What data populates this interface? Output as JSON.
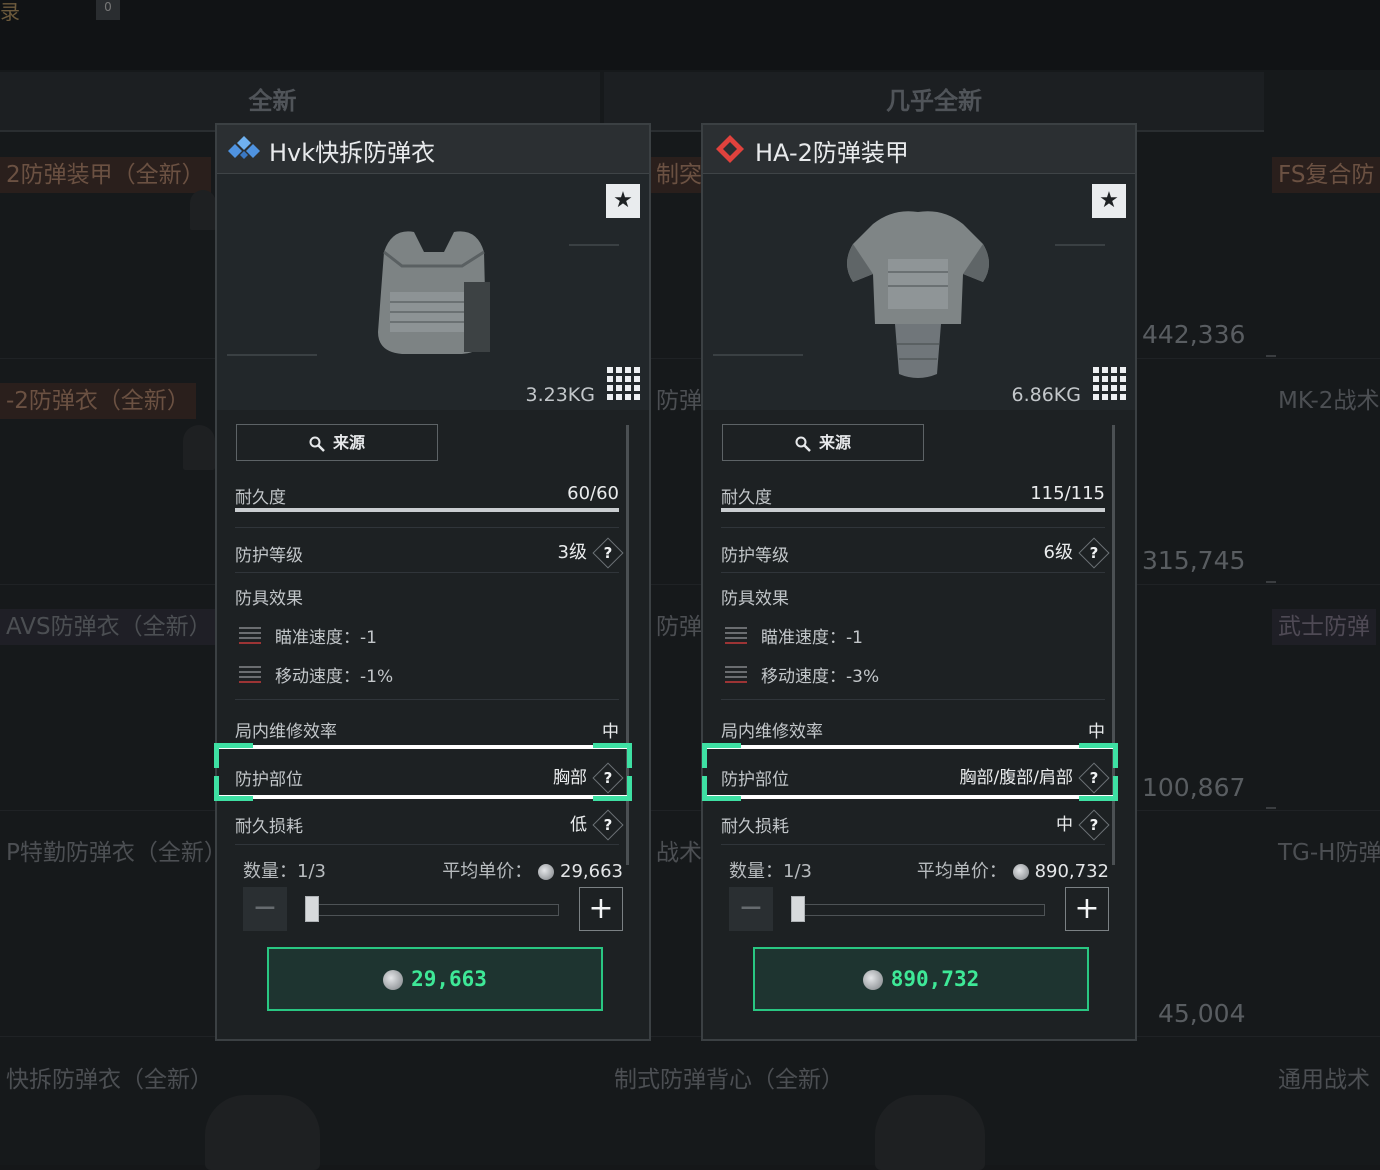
{
  "background": {
    "top_label": "录",
    "top_badge": "0",
    "column_headers": [
      "全新",
      "几乎全新"
    ],
    "left_items": [
      "2防弹装甲（全新）",
      "-2防弹衣（全新）",
      "AVS防弹衣（全新）",
      "P特勤防弹衣（全新）",
      "快拆防弹衣（全新）"
    ],
    "middle_items": [
      "制突击",
      "防弹",
      "防弹",
      "战术",
      "制式防弹背心（全新）"
    ],
    "right_items": [
      "FS复合防",
      "MK-2战术",
      "武士防弹",
      "TG-H防弹",
      "通用战术"
    ],
    "prices": [
      "442,336",
      "315,745",
      "100,867",
      "45,004"
    ]
  },
  "cards": [
    {
      "name": "Hvk快拆防弹衣",
      "quality_icon": "blue-diamonds-icon",
      "weight": "3.23KG",
      "source_label": "来源",
      "durability_label": "耐久度",
      "durability_value": "60/60",
      "durability_fraction": 1.0,
      "protection_level_label": "防护等级",
      "protection_level_value": "3级",
      "effects_label": "防具效果",
      "effect_aim": "瞄准速度：-1",
      "effect_move": "移动速度：-1%",
      "repair_label": "局内维修效率",
      "repair_value": "中",
      "area_label": "防护部位",
      "area_value": "胸部",
      "wear_label": "耐久损耗",
      "wear_value": "低",
      "qty_label": "数量：1/3",
      "avg_price_label": "平均单价：",
      "avg_price_value": "29,663",
      "buy_price": "29,663",
      "help_mark": "?",
      "favorite_glyph": "★",
      "minus_glyph": "−",
      "plus_glyph": "+"
    },
    {
      "name": "HA-2防弹装甲",
      "quality_icon": "red-diamond-icon",
      "weight": "6.86KG",
      "source_label": "来源",
      "durability_label": "耐久度",
      "durability_value": "115/115",
      "durability_fraction": 1.0,
      "protection_level_label": "防护等级",
      "protection_level_value": "6级",
      "effects_label": "防具效果",
      "effect_aim": "瞄准速度：-1",
      "effect_move": "移动速度：-3%",
      "repair_label": "局内维修效率",
      "repair_value": "中",
      "area_label": "防护部位",
      "area_value": "胸部/腹部/肩部",
      "wear_label": "耐久损耗",
      "wear_value": "中",
      "qty_label": "数量：1/3",
      "avg_price_label": "平均单价：",
      "avg_price_value": "890,732",
      "buy_price": "890,732",
      "help_mark": "?",
      "favorite_glyph": "★",
      "minus_glyph": "−",
      "plus_glyph": "+"
    }
  ],
  "colors": {
    "accent_green": "#3ee897",
    "highlight_green": "#3ee0a3",
    "quality_blue": "#4f93e0",
    "quality_red": "#e0423d",
    "effect_red": "#9c3435"
  }
}
